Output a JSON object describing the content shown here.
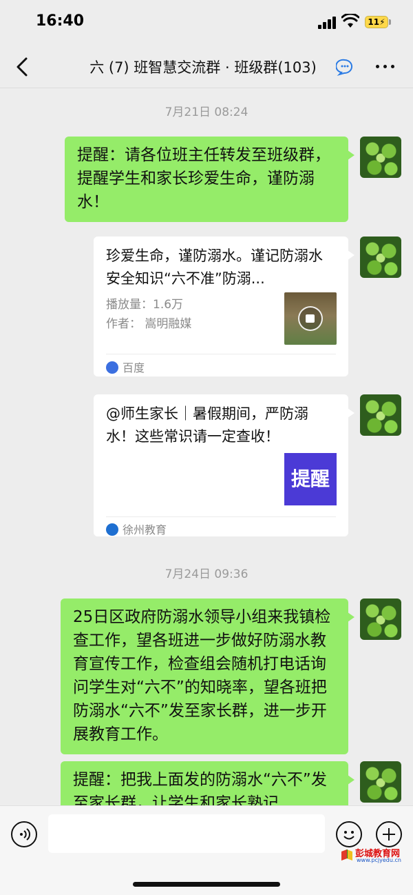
{
  "status_bar": {
    "time": "16:40",
    "battery": "11"
  },
  "header": {
    "title": "六 (7) 班智慧交流群 · 班级群(103)",
    "icons": [
      "back-arrow-icon",
      "chat-bubble-icon",
      "more-icon"
    ]
  },
  "messages": {
    "ts1": "7月21日 08:24",
    "m1_text": "提醒：请各位班主任转发至班级群，提醒学生和家长珍爱生命，谨防溺水！",
    "card1": {
      "title": "珍爱生命，谨防溺水。谨记防溺水安全知识“六不准”防溺...",
      "plays": "播放量：1.6万",
      "author": "作者：  嵩明融媒",
      "source": "百度"
    },
    "card2": {
      "title": "@师生家长｜暑假期间，严防溺水！这些常识请一定查收！",
      "thumb_text": "提醒",
      "source": "徐州教育"
    },
    "ts2": "7月24日 09:36",
    "m2_text": "25日区政府防溺水领导小组来我镇检查工作，望各班进一步做好防溺水教育宣传工作，检查组会随机打电话询问学生对“六不”的知晓率，望各班把防溺水“六不”发至家长群，进一步开展教育工作。",
    "m3_text": "提醒：把我上面发的防溺水“六不”发至家长群，让学生和家长熟记"
  },
  "input_bar": {
    "placeholder": "",
    "icons": [
      "voice-icon",
      "emoji-icon",
      "plus-icon"
    ]
  },
  "watermark": {
    "name": "彭城教育网",
    "url": "www.pcjyedu.cn"
  },
  "colors": {
    "bubble_green": "#95ec69",
    "background": "#ededed",
    "remind_thumb": "#4b3ad6"
  }
}
